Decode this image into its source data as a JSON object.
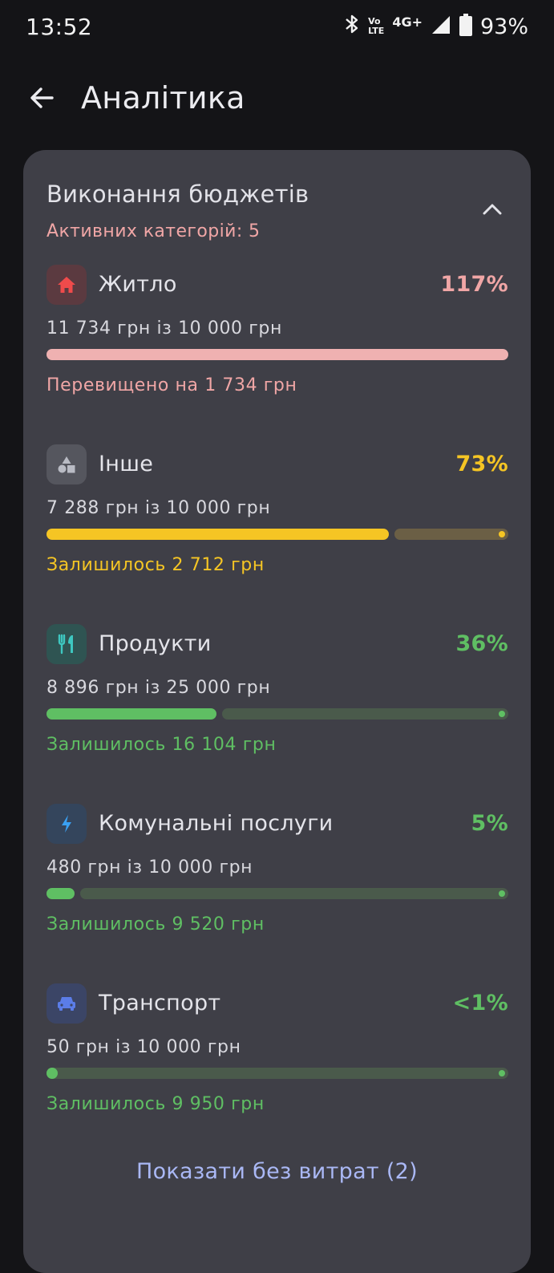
{
  "status": {
    "time": "13:52",
    "volte_top": "Vo",
    "volte_bottom": "LTE",
    "network": "4G+",
    "battery": "93%"
  },
  "header": {
    "title": "Аналітика"
  },
  "card": {
    "title": "Виконання бюджетів",
    "subtitle": "Активних категорій: 5",
    "budgets": [
      {
        "name": "Житло",
        "percent": "117%",
        "amount": "11 734 грн із 10 000 грн",
        "note": "Перевищено на 1 734 грн",
        "fill": 1.0,
        "icon": "home-icon",
        "color": "#f0a6a6",
        "bar_color": "#efb1b1"
      },
      {
        "name": "Інше",
        "percent": "73%",
        "amount": "7 288 грн із 10 000 грн",
        "note": "Залишилось 2 712 грн",
        "fill": 0.7288,
        "icon": "shapes-icon",
        "color": "#f5c524",
        "bar_color": "#f5c524"
      },
      {
        "name": "Продукти",
        "percent": "36%",
        "amount": "8 896 грн із 25 000 грн",
        "note": "Залишилось 16 104 грн",
        "fill": 0.3558,
        "icon": "restaurant-icon",
        "color": "#5fbf63",
        "bar_color": "#5fbf63"
      },
      {
        "name": "Комунальні послуги",
        "percent": "5%",
        "amount": "480 грн із 10 000 грн",
        "note": "Залишилось 9 520 грн",
        "fill": 0.048,
        "icon": "bolt-icon",
        "color": "#5fbf63",
        "bar_color": "#5fbf63"
      },
      {
        "name": "Транспорт",
        "percent": "<1%",
        "amount": "50 грн із 10 000 грн",
        "note": "Залишилось 9 950 грн",
        "fill": 0.005,
        "icon": "car-icon",
        "color": "#5fbf63",
        "bar_color": "#5fbf63"
      }
    ],
    "show_more": "Показати без витрат (2)"
  }
}
